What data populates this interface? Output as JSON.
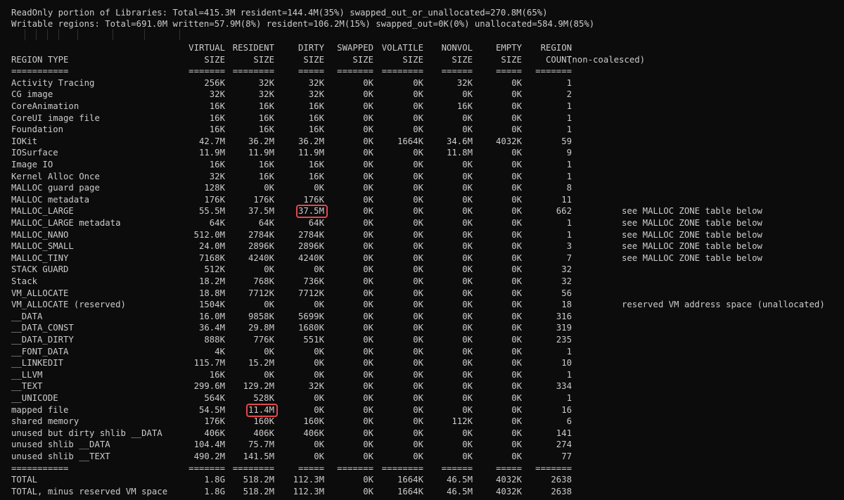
{
  "summary": {
    "line1": "ReadOnly portion of Libraries: Total=415.3M resident=144.4M(35%) swapped_out_or_unallocated=270.8M(65%)",
    "line2": "Writable regions: Total=691.0M written=57.9M(8%) resident=106.2M(15%) swapped_out=0K(0%) unallocated=584.9M(85%)"
  },
  "header": {
    "row1": [
      "",
      "VIRTUAL",
      "RESIDENT",
      "DIRTY",
      "SWAPPED",
      "VOLATILE",
      "NONVOL",
      "EMPTY",
      "REGION",
      ""
    ],
    "row2": [
      "REGION TYPE",
      "SIZE",
      "SIZE",
      "SIZE",
      "SIZE",
      "SIZE",
      "SIZE",
      "SIZE",
      "COUNT",
      "(non-coalesced)"
    ],
    "separator": [
      "===========",
      "=======",
      "========",
      "=====",
      "=======",
      "========",
      "======",
      "=====",
      "=======",
      ""
    ]
  },
  "rows": [
    [
      "Activity Tracing",
      "256K",
      "32K",
      "32K",
      "0K",
      "0K",
      "32K",
      "0K",
      "1",
      ""
    ],
    [
      "CG image",
      "32K",
      "32K",
      "32K",
      "0K",
      "0K",
      "0K",
      "0K",
      "2",
      ""
    ],
    [
      "CoreAnimation",
      "16K",
      "16K",
      "16K",
      "0K",
      "0K",
      "16K",
      "0K",
      "1",
      ""
    ],
    [
      "CoreUI image file",
      "16K",
      "16K",
      "16K",
      "0K",
      "0K",
      "0K",
      "0K",
      "1",
      ""
    ],
    [
      "Foundation",
      "16K",
      "16K",
      "16K",
      "0K",
      "0K",
      "0K",
      "0K",
      "1",
      ""
    ],
    [
      "IOKit",
      "42.7M",
      "36.2M",
      "36.2M",
      "0K",
      "1664K",
      "34.6M",
      "4032K",
      "59",
      ""
    ],
    [
      "IOSurface",
      "11.9M",
      "11.9M",
      "11.9M",
      "0K",
      "0K",
      "11.8M",
      "0K",
      "9",
      ""
    ],
    [
      "Image IO",
      "16K",
      "16K",
      "16K",
      "0K",
      "0K",
      "0K",
      "0K",
      "1",
      ""
    ],
    [
      "Kernel Alloc Once",
      "32K",
      "16K",
      "16K",
      "0K",
      "0K",
      "0K",
      "0K",
      "1",
      ""
    ],
    [
      "MALLOC guard page",
      "128K",
      "0K",
      "0K",
      "0K",
      "0K",
      "0K",
      "0K",
      "8",
      ""
    ],
    [
      "MALLOC metadata",
      "176K",
      "176K",
      "176K",
      "0K",
      "0K",
      "0K",
      "0K",
      "11",
      ""
    ],
    [
      "MALLOC_LARGE",
      "55.5M",
      "37.5M",
      "37.5M",
      "0K",
      "0K",
      "0K",
      "0K",
      "662",
      "see MALLOC ZONE table below"
    ],
    [
      "MALLOC_LARGE metadata",
      "64K",
      "64K",
      "64K",
      "0K",
      "0K",
      "0K",
      "0K",
      "1",
      "see MALLOC ZONE table below"
    ],
    [
      "MALLOC_NANO",
      "512.0M",
      "2784K",
      "2784K",
      "0K",
      "0K",
      "0K",
      "0K",
      "1",
      "see MALLOC ZONE table below"
    ],
    [
      "MALLOC_SMALL",
      "24.0M",
      "2896K",
      "2896K",
      "0K",
      "0K",
      "0K",
      "0K",
      "3",
      "see MALLOC ZONE table below"
    ],
    [
      "MALLOC_TINY",
      "7168K",
      "4240K",
      "4240K",
      "0K",
      "0K",
      "0K",
      "0K",
      "7",
      "see MALLOC ZONE table below"
    ],
    [
      "STACK GUARD",
      "512K",
      "0K",
      "0K",
      "0K",
      "0K",
      "0K",
      "0K",
      "32",
      ""
    ],
    [
      "Stack",
      "18.2M",
      "768K",
      "736K",
      "0K",
      "0K",
      "0K",
      "0K",
      "32",
      ""
    ],
    [
      "VM_ALLOCATE",
      "18.8M",
      "7712K",
      "7712K",
      "0K",
      "0K",
      "0K",
      "0K",
      "56",
      ""
    ],
    [
      "VM_ALLOCATE (reserved)",
      "1504K",
      "0K",
      "0K",
      "0K",
      "0K",
      "0K",
      "0K",
      "18",
      "reserved VM address space (unallocated)"
    ],
    [
      "__DATA",
      "16.0M",
      "9858K",
      "5699K",
      "0K",
      "0K",
      "0K",
      "0K",
      "316",
      ""
    ],
    [
      "__DATA_CONST",
      "36.4M",
      "29.8M",
      "1680K",
      "0K",
      "0K",
      "0K",
      "0K",
      "319",
      ""
    ],
    [
      "__DATA_DIRTY",
      "888K",
      "776K",
      "551K",
      "0K",
      "0K",
      "0K",
      "0K",
      "235",
      ""
    ],
    [
      "__FONT_DATA",
      "4K",
      "0K",
      "0K",
      "0K",
      "0K",
      "0K",
      "0K",
      "1",
      ""
    ],
    [
      "__LINKEDIT",
      "115.7M",
      "15.2M",
      "0K",
      "0K",
      "0K",
      "0K",
      "0K",
      "10",
      ""
    ],
    [
      "__LLVM",
      "16K",
      "0K",
      "0K",
      "0K",
      "0K",
      "0K",
      "0K",
      "1",
      ""
    ],
    [
      "__TEXT",
      "299.6M",
      "129.2M",
      "32K",
      "0K",
      "0K",
      "0K",
      "0K",
      "334",
      ""
    ],
    [
      "__UNICODE",
      "564K",
      "528K",
      "0K",
      "0K",
      "0K",
      "0K",
      "0K",
      "1",
      ""
    ],
    [
      "mapped file",
      "54.5M",
      "11.4M",
      "0K",
      "0K",
      "0K",
      "0K",
      "0K",
      "16",
      ""
    ],
    [
      "shared memory",
      "176K",
      "160K",
      "160K",
      "0K",
      "0K",
      "112K",
      "0K",
      "6",
      ""
    ],
    [
      "unused but dirty shlib __DATA",
      "406K",
      "406K",
      "406K",
      "0K",
      "0K",
      "0K",
      "0K",
      "141",
      ""
    ],
    [
      "unused shlib __DATA",
      "104.4M",
      "75.7M",
      "0K",
      "0K",
      "0K",
      "0K",
      "0K",
      "274",
      ""
    ],
    [
      "unused shlib __TEXT",
      "490.2M",
      "141.5M",
      "0K",
      "0K",
      "0K",
      "0K",
      "0K",
      "77",
      ""
    ]
  ],
  "footer_separator": [
    "===========",
    "=======",
    "========",
    "=====",
    "=======",
    "========",
    "======",
    "=====",
    "=======",
    ""
  ],
  "totals": [
    [
      "TOTAL",
      "1.8G",
      "518.2M",
      "112.3M",
      "0K",
      "1664K",
      "46.5M",
      "4032K",
      "2638",
      ""
    ],
    [
      "TOTAL, minus reserved VM space",
      "1.8G",
      "518.2M",
      "112.3M",
      "0K",
      "1664K",
      "46.5M",
      "4032K",
      "2638",
      ""
    ]
  ],
  "highlights": [
    {
      "row": 11,
      "col": 3,
      "value": "37.5M"
    },
    {
      "row": 28,
      "col": 2,
      "value": "11.4M"
    }
  ],
  "colors": {
    "background": "#0c0c0c",
    "text": "#cccccc",
    "highlight": "#e5484d"
  }
}
